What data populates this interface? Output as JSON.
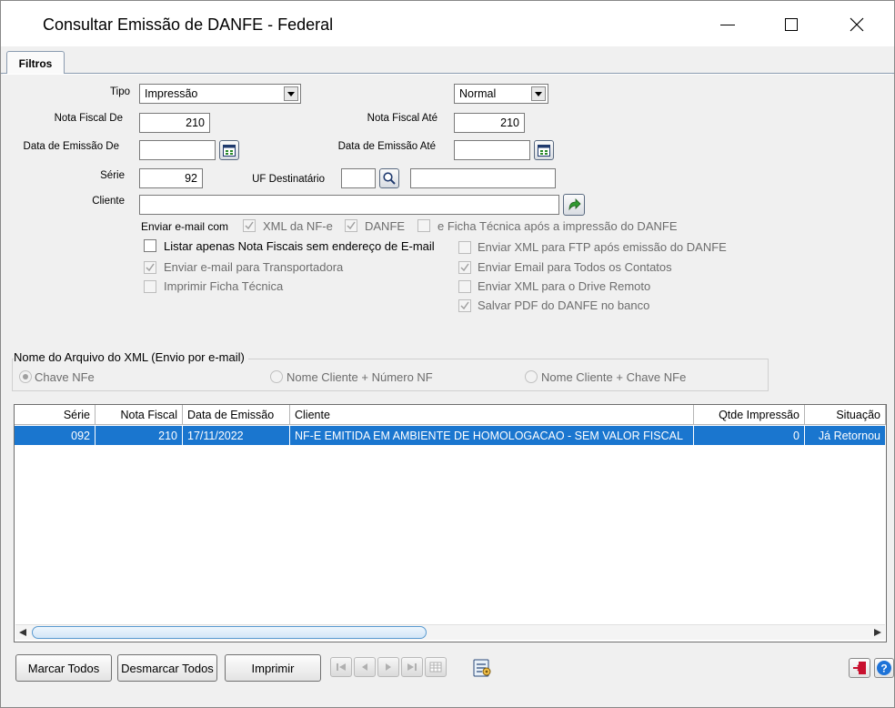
{
  "window": {
    "title": "Consultar Emissão de DANFE - Federal",
    "minimize_symbol": "—",
    "close_symbol": "✕"
  },
  "tabs": [
    {
      "label": "Filtros"
    }
  ],
  "filters": {
    "tipo": {
      "label": "Tipo",
      "value": "Impressão"
    },
    "modo": {
      "value": "Normal"
    },
    "nota_fiscal_de": {
      "label": "Nota Fiscal De",
      "value": "210"
    },
    "nota_fiscal_ate": {
      "label": "Nota Fiscal Até",
      "value": "210"
    },
    "data_emissao_de": {
      "label": "Data de Emissão De",
      "value": ""
    },
    "data_emissao_ate": {
      "label": "Data de Emissão Até",
      "value": ""
    },
    "serie": {
      "label": "Série",
      "value": "92"
    },
    "uf_destinatario": {
      "label": "UF Destinatário",
      "value": "",
      "desc": ""
    },
    "cliente": {
      "label": "Cliente",
      "value": ""
    }
  },
  "email_options": {
    "enviar_email_com": "Enviar e-mail com",
    "xml_nfe": {
      "label": "XML da NF-e",
      "checked": true
    },
    "danfe": {
      "label": "DANFE",
      "checked": true
    },
    "ficha_tecnica": {
      "label": "e Ficha Técnica após a impressão do DANFE",
      "checked": false
    }
  },
  "checkboxes": {
    "listar_sem_email": {
      "label": "Listar apenas Nota Fiscais sem endereço de E-mail",
      "checked": false
    },
    "enviar_transportadora": {
      "label": "Enviar e-mail para Transportadora",
      "checked": true
    },
    "imprimir_ficha": {
      "label": "Imprimir Ficha Técnica",
      "checked": false
    },
    "enviar_xml_ftp": {
      "label": "Enviar XML para FTP após emissão do DANFE",
      "checked": false
    },
    "enviar_email_contatos": {
      "label": "Enviar Email para Todos os Contatos",
      "checked": true
    },
    "enviar_xml_drive": {
      "label": "Enviar XML para o Drive Remoto",
      "checked": false
    },
    "salvar_pdf": {
      "label": "Salvar PDF do DANFE no banco",
      "checked": true
    }
  },
  "xml_name_group": {
    "title": "Nome do Arquivo do XML (Envio por e-mail)",
    "options": [
      {
        "label": "Chave NFe",
        "selected": true
      },
      {
        "label": "Nome Cliente + Número NF",
        "selected": false
      },
      {
        "label": "Nome Cliente + Chave NFe",
        "selected": false
      }
    ]
  },
  "grid": {
    "columns": [
      "Série",
      "Nota Fiscal",
      "Data de Emissão",
      "Cliente",
      "Qtde Impressão",
      "Situação"
    ],
    "rows": [
      {
        "serie": "092",
        "nota_fiscal": "210",
        "data_emissao": "17/11/2022",
        "cliente": "NF-E EMITIDA EM AMBIENTE DE HOMOLOGACAO - SEM VALOR FISCAL",
        "qtde_impressao": "0",
        "situacao": "Já Retornou"
      }
    ]
  },
  "buttons": {
    "marcar_todos": "Marcar Todos",
    "desmarcar_todos": "Desmarcar Todos",
    "imprimir": "Imprimir"
  },
  "colors": {
    "selection": "#1a76cf",
    "panel": "#f0f0f0",
    "exit_red": "#c8102e",
    "help_blue": "#1e73d8"
  }
}
